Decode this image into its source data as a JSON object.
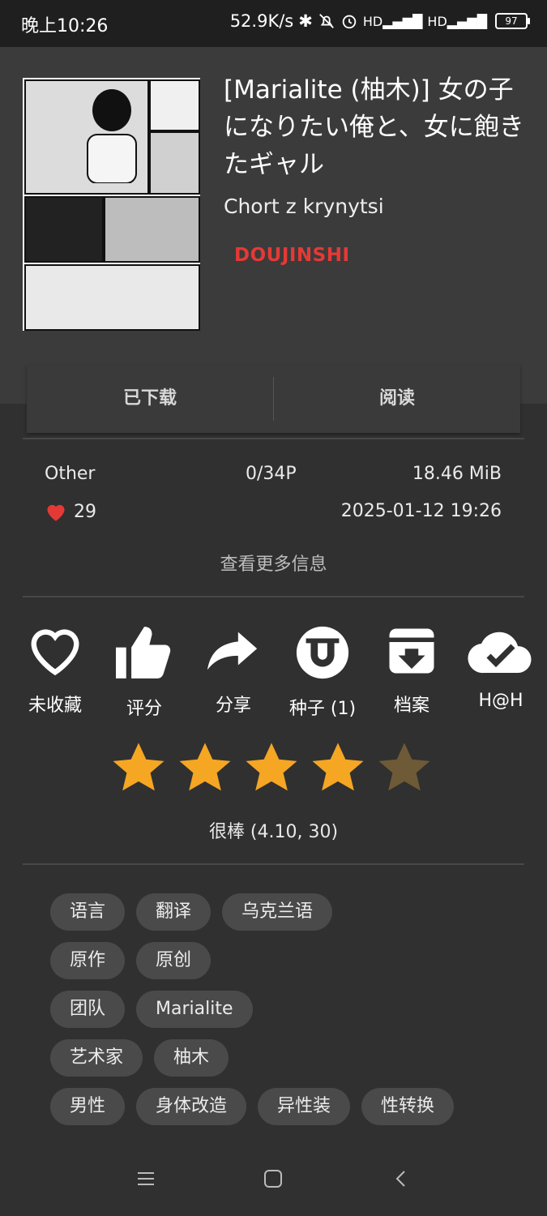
{
  "status_bar": {
    "time": "晚上10:26",
    "net_speed": "52.9K/s",
    "battery": "97"
  },
  "gallery": {
    "title": "[Marialite (柚木)] 女の子になりたい俺と、女に飽きたギャル",
    "artist": "Chort z krynytsi",
    "category": "DOUJINSHI",
    "category_color": "#e53935"
  },
  "actions": {
    "downloaded_label": "已下载",
    "read_label": "阅读"
  },
  "info": {
    "language": "Other",
    "pages": "0/34P",
    "size": "18.46 MiB",
    "favorites": "29",
    "posted": "2025-01-12 19:26",
    "more_info_label": "查看更多信息"
  },
  "icon_actions": [
    {
      "icon": "heart-outline-icon",
      "label": "未收藏"
    },
    {
      "icon": "thumbs-up-icon",
      "label": "评分"
    },
    {
      "icon": "share-icon",
      "label": "分享"
    },
    {
      "icon": "torrent-icon",
      "label": "种子 (1)"
    },
    {
      "icon": "archive-icon",
      "label": "档案"
    },
    {
      "icon": "cloud-check-icon",
      "label": "H@H"
    }
  ],
  "rating": {
    "value": 4.1,
    "filled_stars": 4,
    "total_stars": 5,
    "text": "很棒 (4.10, 30)",
    "star_color": "#f5a623",
    "empty_star_color": "#6e5a36"
  },
  "tags": [
    [
      "语言",
      "翻译",
      "乌克兰语"
    ],
    [
      "原作",
      "原创"
    ],
    [
      "团队",
      "Marialite"
    ],
    [
      "艺术家",
      "柚木"
    ],
    [
      "男性",
      "身体改造",
      "异性装",
      "性转换"
    ]
  ]
}
